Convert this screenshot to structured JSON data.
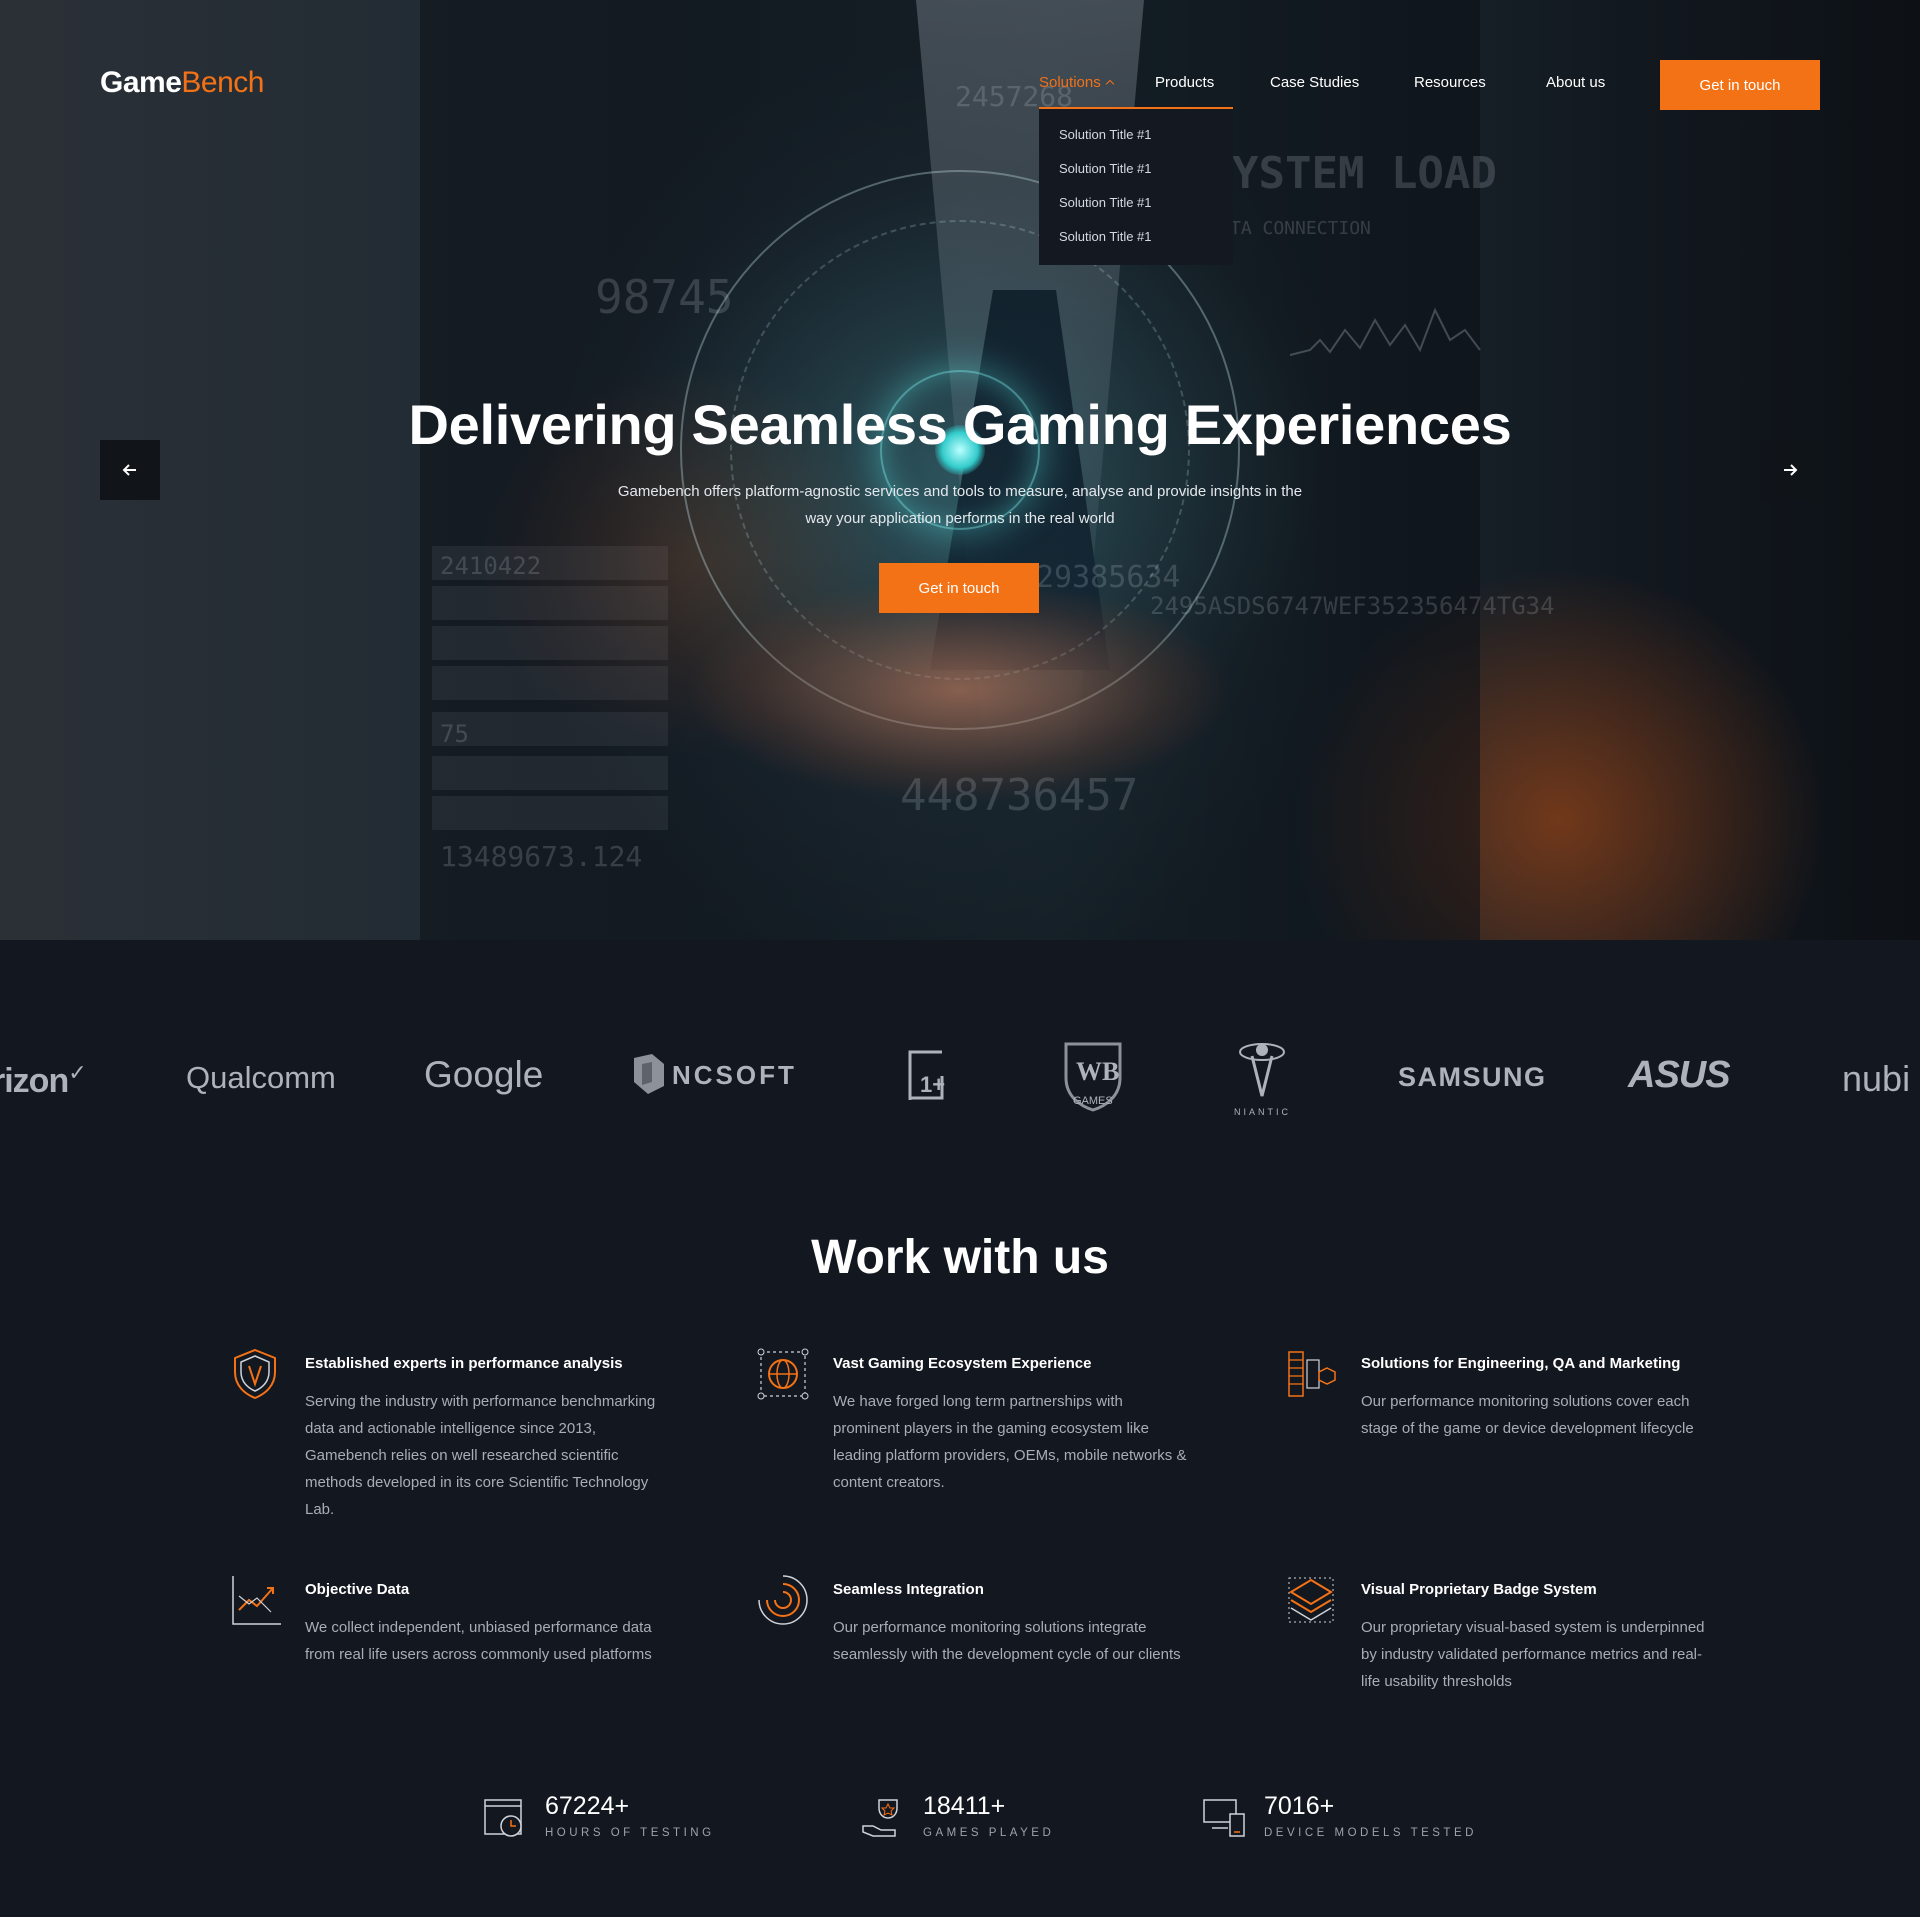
{
  "header": {
    "logo": {
      "part1": "Game",
      "part2": "Bench"
    },
    "nav": [
      {
        "label": "Solutions",
        "active": true
      },
      {
        "label": "Products"
      },
      {
        "label": "Case Studies"
      },
      {
        "label": "Resources"
      },
      {
        "label": "About us"
      }
    ],
    "cta_label": "Get in touch",
    "dropdown": [
      "Solution Title #1",
      "Solution Title #1",
      "Solution Title #1",
      "Solution Title #1"
    ]
  },
  "hero": {
    "title": "Delivering Seamless Gaming Experiences",
    "subtitle": "Gamebench offers platform-agnostic services and tools to measure, analyse and provide insights in the way your application performs in the real world",
    "cta_label": "Get in touch",
    "background_text": {
      "g1": "2457268",
      "g2": "98745",
      "g3": "YSTEM LOAD",
      "g4": "TA CONNECTION",
      "g5": "29385634",
      "g6": "2495ASDS6747WEF352356474TG34",
      "g7": "448736457",
      "g8": "2410422",
      "g9": "75",
      "g10": "13489673.124"
    },
    "prev_icon": "arrow-left-icon",
    "next_icon": "arrow-right-icon"
  },
  "clients": [
    "verizon",
    "Qualcomm",
    "Google",
    "NCSOFT",
    "1+",
    "WB GAMES",
    "NIANTIC",
    "SAMSUNG",
    "ASUS",
    "nubi"
  ],
  "work": {
    "title": "Work with us",
    "features": [
      {
        "icon": "shield-icon",
        "title": "Established experts in performance analysis",
        "text": "Serving the industry with performance benchmarking data and actionable intelligence since 2013, Gamebench relies on well researched scientific methods developed in its core Scientific Technology Lab."
      },
      {
        "icon": "globe-network-icon",
        "title": "Vast Gaming Ecosystem Experience",
        "text": "We have forged long term partnerships with prominent players in the gaming ecosystem like leading platform providers, OEMs, mobile networks & content creators."
      },
      {
        "icon": "server-cube-icon",
        "title": "Solutions for Engineering, QA and Marketing",
        "text": "Our performance monitoring solutions cover each stage of the game or device development lifecycle"
      },
      {
        "icon": "line-chart-icon",
        "title": "Objective Data",
        "text": "We collect independent, unbiased performance data from real life users  across commonly used platforms"
      },
      {
        "icon": "integration-arcs-icon",
        "title": "Seamless Integration",
        "text": "Our performance monitoring solutions integrate seamlessly with the development cycle of our clients"
      },
      {
        "icon": "layered-badge-icon",
        "title": "Visual Proprietary Badge System",
        "text": "Our proprietary visual-based system is underpinned by industry validated performance metrics and real-life usability thresholds"
      }
    ]
  },
  "stats": [
    {
      "icon": "stopwatch-icon",
      "value": "67224+",
      "label": "HOURS OF TESTING"
    },
    {
      "icon": "trophy-hand-icon",
      "value": "18411+",
      "label": "GAMES PLAYED"
    },
    {
      "icon": "devices-icon",
      "value": "7016+",
      "label": "DEVICE MODELS TESTED"
    }
  ],
  "colors": {
    "accent": "#f47216",
    "background": "#131720",
    "dropdown_bg": "#141821",
    "muted_text": "#a8adb6"
  }
}
